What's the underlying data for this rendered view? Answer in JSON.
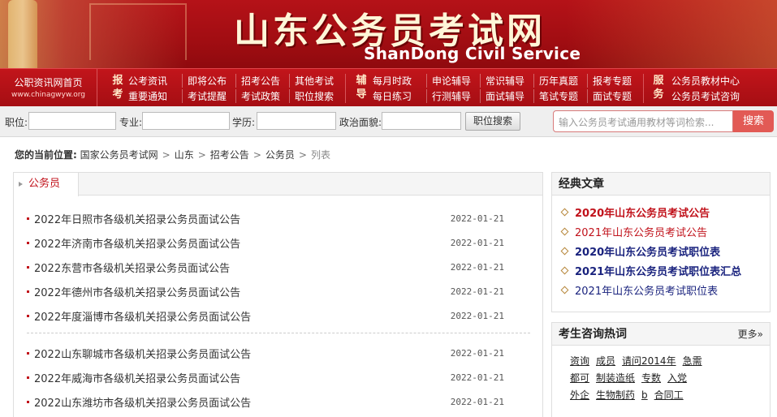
{
  "header": {
    "title": "山东公务员考试网",
    "subtitle": "ShanDong Civil Service"
  },
  "nav": {
    "home_title": "公职资讯网首页",
    "home_url": "www.chinagwyw.org",
    "cat1": "报考",
    "cat2": "辅导",
    "cat3": "服务",
    "group1_row1": [
      "公考资讯",
      "即将公布",
      "招考公告",
      "其他考试"
    ],
    "group1_row2": [
      "重要通知",
      "考试提醒",
      "考试政策",
      "职位搜索"
    ],
    "group2_row1": [
      "每月时政",
      "申论辅导",
      "常识辅导",
      "历年真题",
      "报考专题"
    ],
    "group2_row2": [
      "每日练习",
      "行测辅导",
      "面试辅导",
      "笔试专题",
      "面试专题"
    ],
    "group3_row1": [
      "公务员教材中心"
    ],
    "group3_row2": [
      "公务员考试咨询"
    ]
  },
  "search": {
    "position_label": "职位:",
    "major_label": "专业:",
    "education_label": "学历:",
    "politics_label": "政治面貌:",
    "position_search_button": "职位搜索",
    "keyword_placeholder": "输入公务员考试通用教材等词检索...",
    "search_button": "搜索"
  },
  "breadcrumb": {
    "label": "您的当前位置:",
    "items": [
      "国家公务员考试网",
      "山东",
      "招考公告",
      "公务员"
    ],
    "last": "列表",
    "separator": ">"
  },
  "main": {
    "tab_label": "公务员",
    "news": [
      {
        "title": "2022年日照市各级机关招录公务员面试公告",
        "date": "2022-01-21"
      },
      {
        "title": "2022年济南市各级机关招录公务员面试公告",
        "date": "2022-01-21"
      },
      {
        "title": "2022东营市各级机关招录公务员面试公告",
        "date": "2022-01-21"
      },
      {
        "title": "2022年德州市各级机关招录公务员面试公告",
        "date": "2022-01-21"
      },
      {
        "title": "2022年度淄博市各级机关招录公务员面试公告",
        "date": "2022-01-21"
      },
      {
        "title": "2022山东聊城市各级机关招录公务员面试公告",
        "date": "2022-01-21"
      },
      {
        "title": "2022年威海市各级机关招录公务员面试公告",
        "date": "2022-01-21"
      },
      {
        "title": "2022山东潍坊市各级机关招录公务员面试公告",
        "date": "2022-01-21"
      }
    ]
  },
  "classic": {
    "heading": "经典文章",
    "items": [
      {
        "title": "2020年山东公务员考试公告",
        "color": "#c1121b",
        "bold": true
      },
      {
        "title": "2021年山东公务员考试公告",
        "color": "#c1121b",
        "bold": false
      },
      {
        "title": "2020年山东公务员考试职位表",
        "color": "#1a237e",
        "bold": true
      },
      {
        "title": "2021年山东公务员考试职位表汇总",
        "color": "#1a237e",
        "bold": true
      },
      {
        "title": "2021年山东公务员考试职位表",
        "color": "#1a237e",
        "bold": false
      }
    ]
  },
  "hot": {
    "heading": "考生咨询热词",
    "more": "更多»",
    "rows": [
      [
        "资询",
        "成员",
        "请问2014年",
        "急需"
      ],
      [
        "都可",
        "制装造纸",
        "专数",
        "入党"
      ],
      [
        "外企",
        "生物制药",
        "b",
        "合同工"
      ]
    ]
  },
  "colors": {
    "brand_red": "#b51218",
    "accent_red": "#c1121b",
    "link_navy": "#1a237e"
  }
}
